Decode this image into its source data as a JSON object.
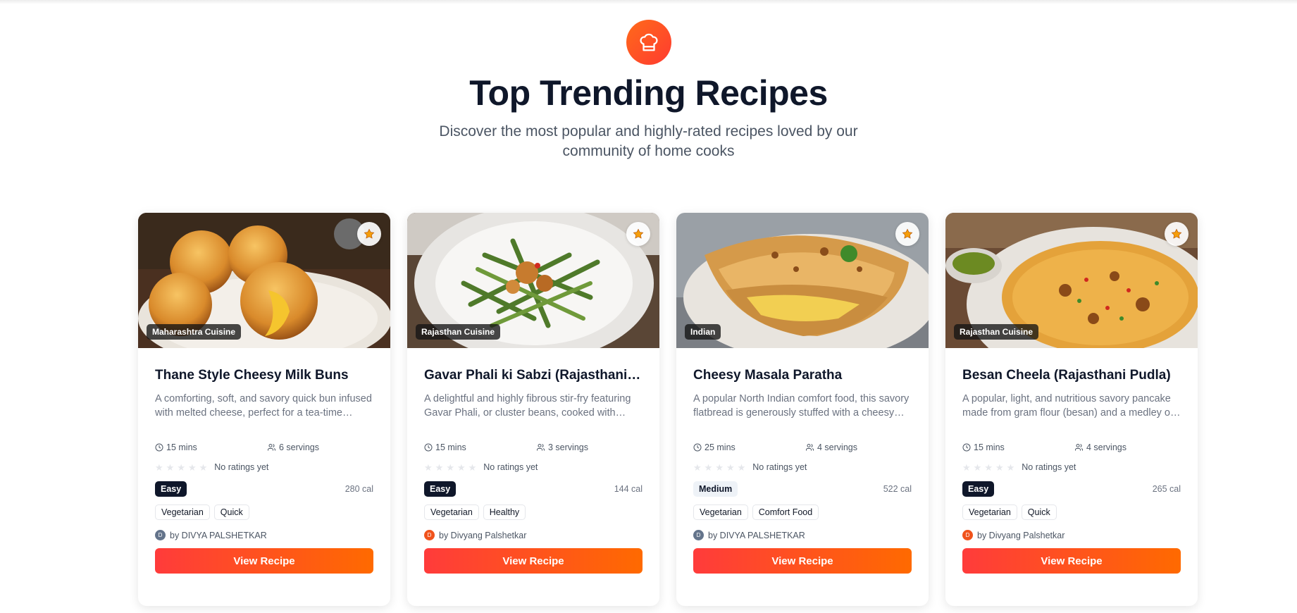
{
  "hero": {
    "icon": "chef-hat-icon",
    "title": "Top Trending Recipes",
    "subtitle": "Discover the most popular and highly-rated recipes loved by our community of home cooks"
  },
  "colors": {
    "accent_start": "#ff3b3b",
    "accent_end": "#ff6a00",
    "dark_badge": "#0f172a",
    "star_favorite": "#f59e0b",
    "avatar_gray": "#64748b",
    "avatar_orange": "#f0531c"
  },
  "recipes": [
    {
      "cuisine": "Maharashtra Cuisine",
      "title": "Thane Style Cheesy Milk Buns",
      "description": "A comforting, soft, and savory quick bun infused with melted cheese, perfect for a tea-time snack.",
      "time": "15 mins",
      "servings": "6 servings",
      "rating_text": "No ratings yet",
      "difficulty": "Easy",
      "calories": "280 cal",
      "tags": [
        "Vegetarian",
        "Quick"
      ],
      "author": "by DIVYA PALSHETKAR",
      "avatar_letter": "D",
      "cta": "View Recipe"
    },
    {
      "cuisine": "Rajasthan Cuisine",
      "title": "Gavar Phali ki Sabzi (Rajasthani Style)",
      "description": "A delightful and highly fibrous stir-fry featuring Gavar Phali, or cluster beans, cooked with spices.",
      "time": "15 mins",
      "servings": "3 servings",
      "rating_text": "No ratings yet",
      "difficulty": "Easy",
      "calories": "144 cal",
      "tags": [
        "Vegetarian",
        "Healthy"
      ],
      "author": "by Divyang Palshetkar",
      "avatar_letter": "D",
      "cta": "View Recipe"
    },
    {
      "cuisine": "Indian",
      "title": "Cheesy Masala Paratha",
      "description": "A popular North Indian comfort food, this savory flatbread is generously stuffed with a cheesy masala.",
      "time": "25 mins",
      "servings": "4 servings",
      "rating_text": "No ratings yet",
      "difficulty": "Medium",
      "calories": "522 cal",
      "tags": [
        "Vegetarian",
        "Comfort Food"
      ],
      "author": "by DIVYA PALSHETKAR",
      "avatar_letter": "D",
      "cta": "View Recipe"
    },
    {
      "cuisine": "Rajasthan Cuisine",
      "title": "Besan Cheela (Rajasthani Pudla)",
      "description": "A popular, light, and nutritious savory pancake made from gram flour (besan) and a medley of spices.",
      "time": "15 mins",
      "servings": "4 servings",
      "rating_text": "No ratings yet",
      "difficulty": "Easy",
      "calories": "265 cal",
      "tags": [
        "Vegetarian",
        "Quick"
      ],
      "author": "by Divyang Palshetkar",
      "avatar_letter": "D",
      "cta": "View Recipe"
    }
  ]
}
